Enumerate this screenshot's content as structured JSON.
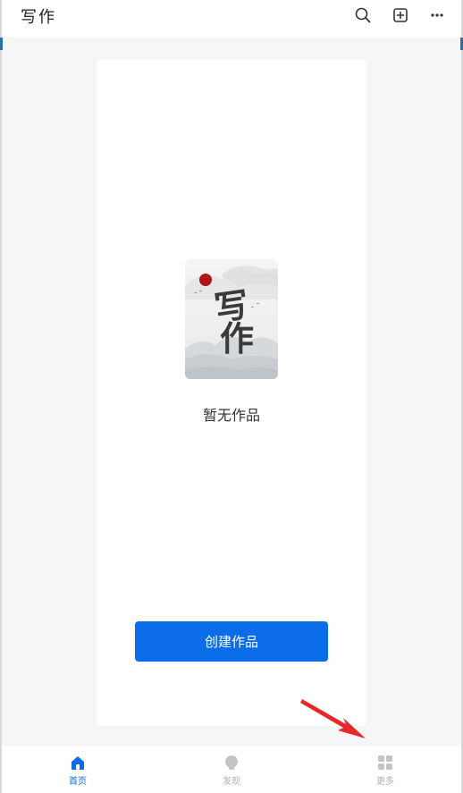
{
  "header": {
    "title": "写作",
    "icons": [
      "search-icon",
      "add-square-icon",
      "more-icon"
    ]
  },
  "main": {
    "empty_text": "暂无作品",
    "create_button_label": "创建作品",
    "illustration": {
      "chars": "写作",
      "sun_color": "#b0141a"
    }
  },
  "bottom_nav": {
    "items": [
      {
        "label": "首页",
        "icon": "home-icon",
        "active": true
      },
      {
        "label": "发现",
        "icon": "discover-icon",
        "active": false
      },
      {
        "label": "更多",
        "icon": "grid-icon",
        "active": false
      }
    ]
  },
  "colors": {
    "accent": "#0a6ce6",
    "background": "#f5f6f7",
    "annotation_arrow": "#e8272c"
  }
}
